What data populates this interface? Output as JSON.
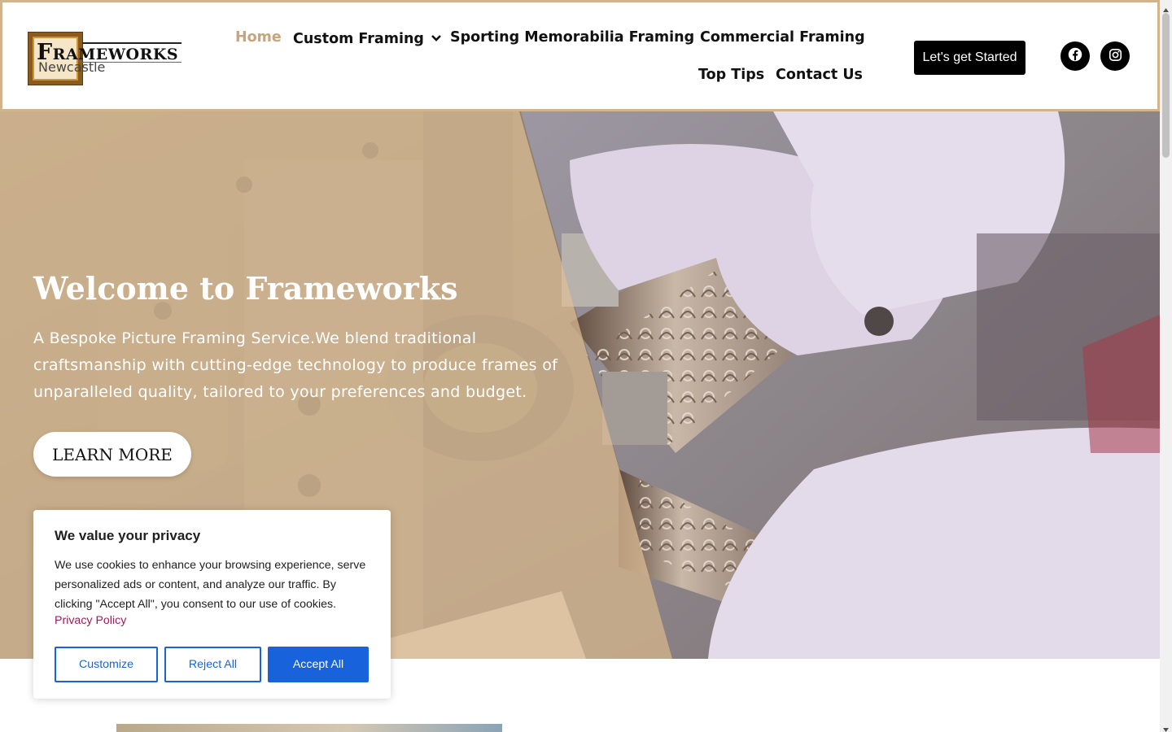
{
  "header": {
    "logo": {
      "line1": "Frameworks",
      "line2": "Newcastle"
    },
    "nav": [
      {
        "label": "Home",
        "active": true
      },
      {
        "label": "Custom Framing",
        "has_dropdown": true
      },
      {
        "label": "Sporting Memorabilia Framing"
      },
      {
        "label": "Commercial Framing"
      },
      {
        "label": "Top Tips"
      },
      {
        "label": "Contact Us"
      }
    ],
    "cta_label": "Let's get Started",
    "social": [
      {
        "icon": "facebook-icon"
      },
      {
        "icon": "instagram-icon"
      }
    ]
  },
  "hero": {
    "title": "Welcome to Frameworks",
    "text": "A Bespoke Picture Framing Service.We blend traditional craftsmanship with cutting-edge technology to produce frames of unparalleled quality, tailored to your preferences and budget.",
    "button_label": "LEARN MORE"
  },
  "cookie": {
    "title": "We value your privacy",
    "body": "We use cookies to enhance your browsing experience, serve personalized ads or content, and analyze our traffic. By clicking \"Accept All\", you consent to our use of cookies.",
    "link": "Privacy Policy",
    "buttons": {
      "customize": "Customize",
      "reject": "Reject All",
      "accept": "Accept All"
    }
  },
  "colors": {
    "header_border": "#d2b48c",
    "nav_active": "#c9a47a",
    "overlay": "#debe96",
    "cookie_primary": "#1863dc",
    "cookie_link": "#a3195b"
  }
}
